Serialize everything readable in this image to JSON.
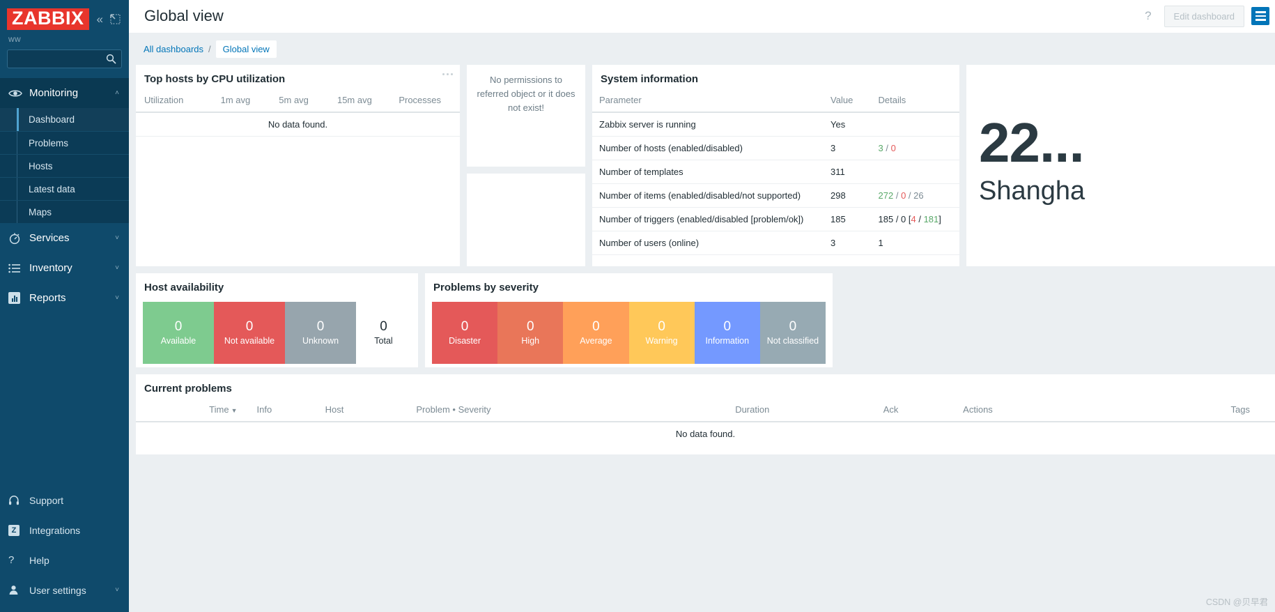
{
  "sidebar": {
    "logo": "ZABBIX",
    "collapse_icon": "chevrons-left-icon",
    "expand_icon": "expand-icon",
    "user": "ww",
    "search_placeholder": "",
    "search_value": "",
    "groups": [
      {
        "label": "Monitoring",
        "icon": "eye-icon",
        "expanded": true,
        "chevron": "˄",
        "items": [
          {
            "label": "Dashboard",
            "selected": true
          },
          {
            "label": "Problems",
            "selected": false
          },
          {
            "label": "Hosts",
            "selected": false
          },
          {
            "label": "Latest data",
            "selected": false
          },
          {
            "label": "Maps",
            "selected": false
          }
        ]
      },
      {
        "label": "Services",
        "icon": "stopwatch-icon",
        "expanded": false,
        "chevron": "˅",
        "items": []
      },
      {
        "label": "Inventory",
        "icon": "list-icon",
        "expanded": false,
        "chevron": "˅",
        "items": []
      },
      {
        "label": "Reports",
        "icon": "bar-chart-icon",
        "expanded": false,
        "chevron": "˅",
        "items": []
      }
    ],
    "bottom": [
      {
        "label": "Support",
        "icon": "headset-icon",
        "chevron": ""
      },
      {
        "label": "Integrations",
        "icon": "zabbix-z-icon",
        "chevron": ""
      },
      {
        "label": "Help",
        "icon": "question-icon",
        "chevron": ""
      },
      {
        "label": "User settings",
        "icon": "user-icon",
        "chevron": "˅"
      }
    ]
  },
  "header": {
    "title": "Global view",
    "help_icon": "?",
    "edit_button": "Edit dashboard",
    "menu_icon": "hamburger-icon"
  },
  "breadcrumb": {
    "root": "All dashboards",
    "separator": "/",
    "current": "Global view"
  },
  "widgets": {
    "top_hosts": {
      "title": "Top hosts by CPU utilization",
      "menu_icon": "ellipsis-icon",
      "columns": [
        "Utilization",
        "1m avg",
        "5m avg",
        "15m avg",
        "Processes"
      ],
      "empty_text": "No data found."
    },
    "no_permissions": {
      "text": "No permissions to referred object or it does not exist!"
    },
    "empty_widget": {
      "text": ""
    },
    "system_information": {
      "title": "System information",
      "columns": [
        "Parameter",
        "Value",
        "Details"
      ],
      "rows": [
        {
          "parameter": "Zabbix server is running",
          "value": "Yes",
          "value_color": "green",
          "details": ""
        },
        {
          "parameter": "Number of hosts (enabled/disabled)",
          "value": "3",
          "value_color": "normal",
          "details": "3 / 0",
          "details_parts": [
            {
              "t": "3",
              "c": "green"
            },
            {
              "t": " / ",
              "c": "gray"
            },
            {
              "t": "0",
              "c": "red"
            }
          ]
        },
        {
          "parameter": "Number of templates",
          "value": "311",
          "value_color": "normal",
          "details": ""
        },
        {
          "parameter": "Number of items (enabled/disabled/not supported)",
          "value": "298",
          "value_color": "normal",
          "details": "272 / 0 / 26",
          "details_parts": [
            {
              "t": "272",
              "c": "green"
            },
            {
              "t": " / ",
              "c": "gray"
            },
            {
              "t": "0",
              "c": "red"
            },
            {
              "t": " / ",
              "c": "gray"
            },
            {
              "t": "26",
              "c": "gray"
            }
          ]
        },
        {
          "parameter": "Number of triggers (enabled/disabled [problem/ok])",
          "value": "185",
          "value_color": "normal",
          "details": "185 / 0 [4 / 181]",
          "details_parts": [
            {
              "t": "185",
              "c": "normal"
            },
            {
              "t": " / ",
              "c": "gray"
            },
            {
              "t": "0",
              "c": "normal"
            },
            {
              "t": " [",
              "c": "gray"
            },
            {
              "t": "4",
              "c": "red"
            },
            {
              "t": " / ",
              "c": "gray"
            },
            {
              "t": "181",
              "c": "green"
            },
            {
              "t": "]",
              "c": "gray"
            }
          ]
        },
        {
          "parameter": "Number of users (online)",
          "value": "3",
          "value_color": "normal",
          "details": "1",
          "details_parts": [
            {
              "t": "1",
              "c": "green"
            }
          ]
        }
      ]
    },
    "clock": {
      "big_value": "22...",
      "sub_value": "Shangha"
    },
    "host_availability": {
      "title": "Host availability",
      "tiles": [
        {
          "count": "0",
          "label": "Available",
          "color": "#7ecb8f",
          "text": "#ffffff"
        },
        {
          "count": "0",
          "label": "Not available",
          "color": "#e45959",
          "text": "#ffffff"
        },
        {
          "count": "0",
          "label": "Unknown",
          "color": "#97a5ad",
          "text": "#ffffff"
        },
        {
          "count": "0",
          "label": "Total",
          "color": "#ffffff",
          "text": "#1f2c33"
        }
      ]
    },
    "problems_by_severity": {
      "title": "Problems by severity",
      "tiles": [
        {
          "count": "0",
          "label": "Disaster",
          "color": "#e45959",
          "text": "#ffffff"
        },
        {
          "count": "0",
          "label": "High",
          "color": "#e97659",
          "text": "#ffffff"
        },
        {
          "count": "0",
          "label": "Average",
          "color": "#ffa059",
          "text": "#ffffff"
        },
        {
          "count": "0",
          "label": "Warning",
          "color": "#ffc859",
          "text": "#ffffff"
        },
        {
          "count": "0",
          "label": "Information",
          "color": "#7499ff",
          "text": "#ffffff"
        },
        {
          "count": "0",
          "label": "Not classified",
          "color": "#97aab3",
          "text": "#ffffff"
        }
      ]
    },
    "current_problems": {
      "title": "Current problems",
      "columns": [
        "Time",
        "Info",
        "Host",
        "Problem • Severity",
        "Duration",
        "Ack",
        "Actions",
        "Tags"
      ],
      "sort_column": "Time",
      "sort_arrow": "▼",
      "empty_text": "No data found."
    }
  },
  "watermark": "CSDN @贝早君"
}
